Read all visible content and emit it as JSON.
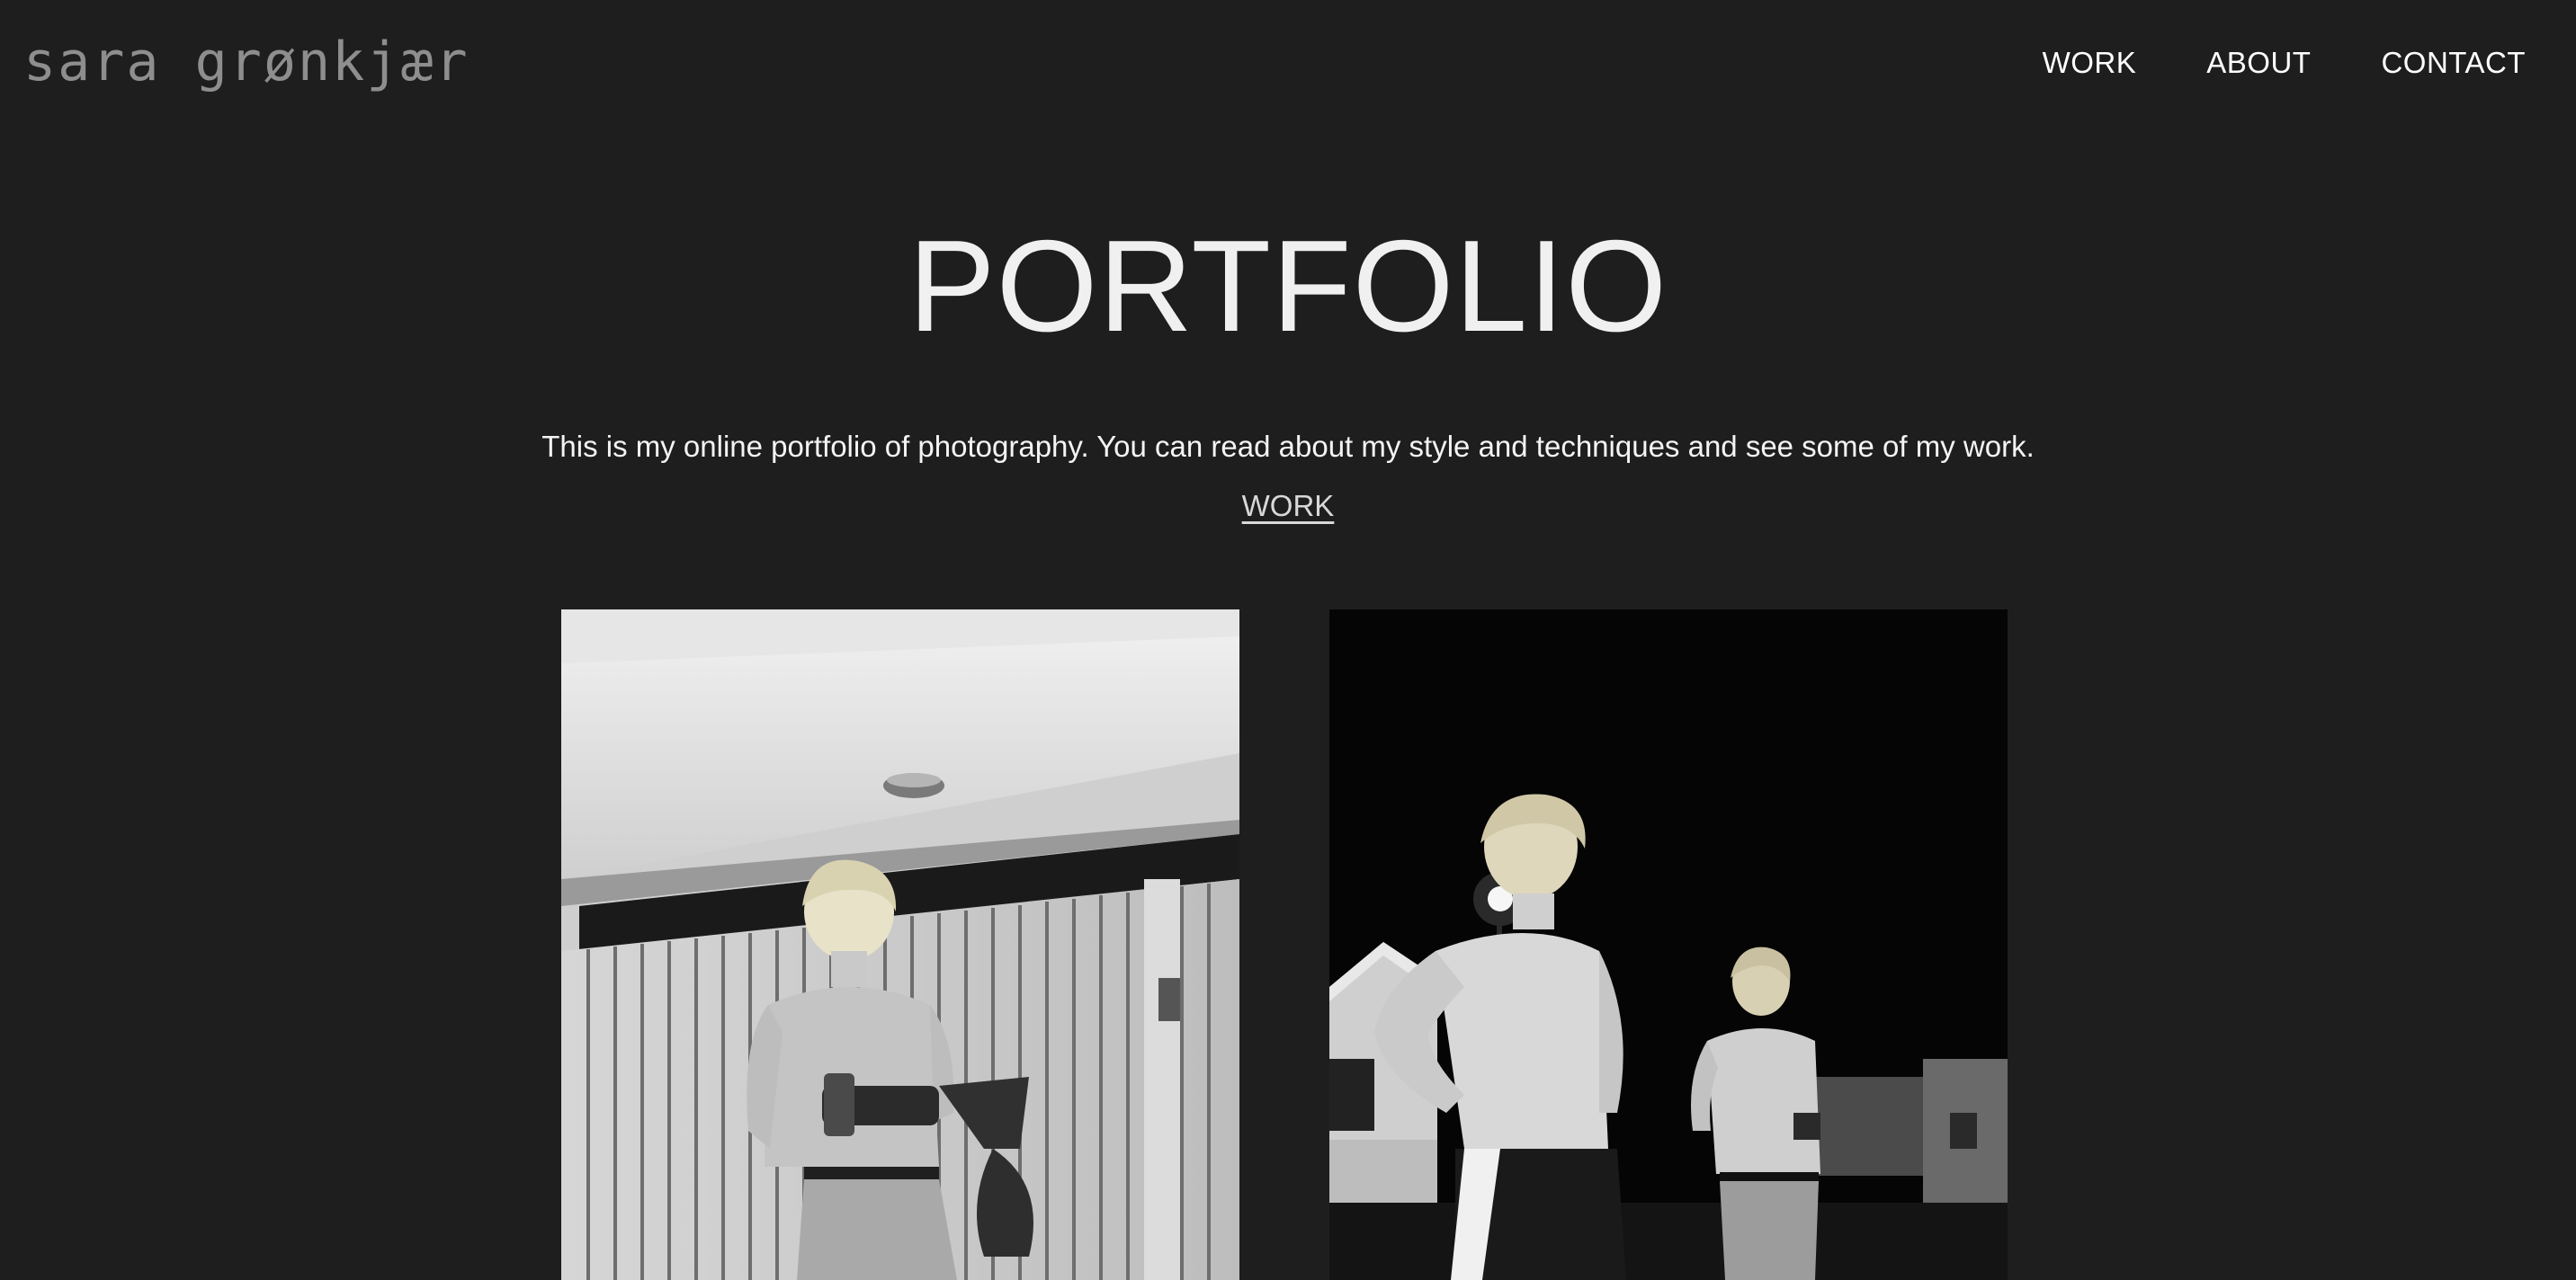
{
  "header": {
    "logo_text": "sara grønkjær",
    "nav": [
      {
        "label": "WORK"
      },
      {
        "label": "ABOUT"
      },
      {
        "label": "CONTACT"
      }
    ]
  },
  "hero": {
    "title": "PORTFOLIO",
    "intro": "This is my online portfolio of photography. You can read about my style and techniques and see some of my work.",
    "link_label": "WORK"
  },
  "colors": {
    "background": "#1e1e1e",
    "text": "#f2f2f2",
    "logo": "#8e8e8e"
  }
}
